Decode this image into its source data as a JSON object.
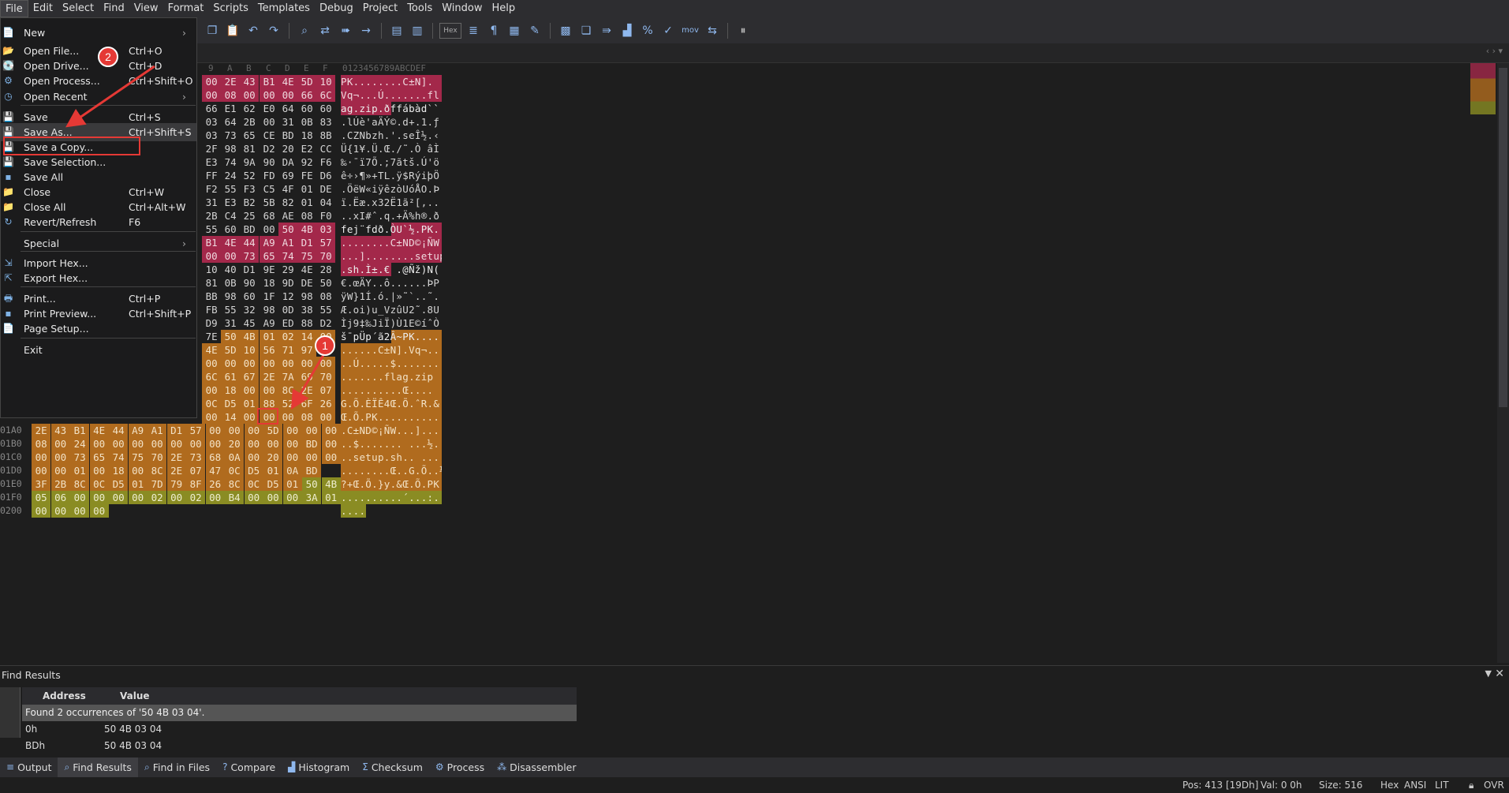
{
  "menubar": [
    "File",
    "Edit",
    "Select",
    "Find",
    "View",
    "Format",
    "Scripts",
    "Templates",
    "Debug",
    "Project",
    "Tools",
    "Window",
    "Help"
  ],
  "toolbar": {
    "hex_label": "Hex",
    "mov_label": "mov",
    "icons": [
      "copy-icon",
      "paste-icon",
      "undo-icon",
      "redo-icon",
      "find-icon",
      "find-replace-icon",
      "find-next-icon",
      "goto-icon",
      "bookmark-icon",
      "bookmark-next-icon",
      "hex-mode-icon",
      "encoding-icon",
      "pilcrow-icon",
      "columns-icon",
      "highlight-icon",
      "calculator-icon",
      "templates-icon",
      "run-icon",
      "histogram-icon",
      "percent-icon",
      "checksum-icon",
      "mov-icon",
      "compare-icon",
      "pause-icon"
    ]
  },
  "file_menu": [
    {
      "label": "New",
      "shortcut": "",
      "submenu": true,
      "icon": "new-file-icon"
    },
    {
      "label": "Open File...",
      "shortcut": "Ctrl+O",
      "icon": "open-folder-icon"
    },
    {
      "label": "Open Drive...",
      "shortcut": "Ctrl+D",
      "icon": "drive-icon"
    },
    {
      "label": "Open Process...",
      "shortcut": "Ctrl+Shift+O",
      "icon": "process-icon"
    },
    {
      "label": "Open Recent",
      "shortcut": "",
      "submenu": true,
      "icon": "recent-icon"
    },
    {
      "label": "Save",
      "shortcut": "Ctrl+S",
      "icon": "save-icon"
    },
    {
      "label": "Save As...",
      "shortcut": "Ctrl+Shift+S",
      "icon": "save-as-icon"
    },
    {
      "label": "Save a Copy...",
      "shortcut": "",
      "icon": "save-copy-icon"
    },
    {
      "label": "Save Selection...",
      "shortcut": "",
      "icon": "save-selection-icon"
    },
    {
      "label": "Save All",
      "shortcut": "",
      "icon": "save-all-icon"
    },
    {
      "label": "Close",
      "shortcut": "Ctrl+W",
      "icon": "close-file-icon"
    },
    {
      "label": "Close All",
      "shortcut": "Ctrl+Alt+W",
      "icon": "close-all-icon"
    },
    {
      "label": "Revert/Refresh",
      "shortcut": "F6",
      "icon": "refresh-icon"
    },
    {
      "label": "Special",
      "shortcut": "",
      "submenu": true,
      "icon": ""
    },
    {
      "label": "Import Hex...",
      "shortcut": "",
      "icon": "import-icon"
    },
    {
      "label": "Export Hex...",
      "shortcut": "",
      "icon": "export-icon"
    },
    {
      "label": "Print...",
      "shortcut": "Ctrl+P",
      "icon": "print-icon"
    },
    {
      "label": "Print Preview...",
      "shortcut": "Ctrl+Shift+P",
      "icon": "print-preview-icon"
    },
    {
      "label": "Page Setup...",
      "shortcut": "",
      "icon": "page-setup-icon"
    },
    {
      "label": "Exit",
      "shortcut": "",
      "icon": ""
    }
  ],
  "annotations": {
    "badge1": "1",
    "badge2": "2"
  },
  "hex_header": {
    "cols": [
      "9",
      "A",
      "B",
      "C",
      "D",
      "E",
      "F"
    ],
    "chars": "0123456789ABCDEF"
  },
  "hex_rows": [
    {
      "addr": "",
      "bytes": [
        "00",
        "2E",
        "43",
        "B1",
        "4E",
        "5D",
        "10"
      ],
      "colors": [
        "p",
        "p",
        "p",
        "p",
        "p",
        "p",
        "p"
      ],
      "chars": "PK........C±N].",
      "ccolor": "p"
    },
    {
      "addr": "",
      "bytes": [
        "00",
        "08",
        "00",
        "00",
        "00",
        "66",
        "6C"
      ],
      "colors": [
        "p",
        "p",
        "p",
        "p",
        "p",
        "p",
        "p"
      ],
      "chars": "Vq¬...Ú.......fl",
      "ccolor": "p"
    },
    {
      "addr": "",
      "bytes": [
        "66",
        "E1",
        "62",
        "E0",
        "64",
        "60",
        "60"
      ],
      "colors": [
        "n",
        "n",
        "n",
        "n",
        "n",
        "n",
        "n"
      ],
      "chars": "ag.zip.ðffábàd``",
      "ccolor": "pn"
    },
    {
      "addr": "",
      "bytes": [
        "03",
        "64",
        "2B",
        "00",
        "31",
        "0B",
        "83"
      ],
      "colors": [
        "n",
        "n",
        "n",
        "n",
        "n",
        "n",
        "n"
      ],
      "chars": ".lÚè'aÄÝ©.d+.1.ƒ",
      "ccolor": "n"
    },
    {
      "addr": "",
      "bytes": [
        "03",
        "73",
        "65",
        "CE",
        "BD",
        "18",
        "8B"
      ],
      "colors": [
        "n",
        "n",
        "n",
        "n",
        "n",
        "n",
        "n"
      ],
      "chars": ".CZNbzh.'.seÎ½.‹",
      "ccolor": "n"
    },
    {
      "addr": "",
      "bytes": [
        "2F",
        "98",
        "81",
        "D2",
        "20",
        "E2",
        "CC"
      ],
      "colors": [
        "n",
        "n",
        "n",
        "n",
        "n",
        "n",
        "n"
      ],
      "chars": "Ü{1¥.Ü.Œ./˜.Ò âÌ",
      "ccolor": "n"
    },
    {
      "addr": "",
      "bytes": [
        "E3",
        "74",
        "9A",
        "90",
        "DA",
        "92",
        "F6"
      ],
      "colors": [
        "n",
        "n",
        "n",
        "n",
        "n",
        "n",
        "n"
      ],
      "chars": "‰·¯ï7Õ.;7ãtš.Ú'ö",
      "ccolor": "n"
    },
    {
      "addr": "",
      "bytes": [
        "FF",
        "24",
        "52",
        "FD",
        "69",
        "FE",
        "D6"
      ],
      "colors": [
        "n",
        "n",
        "n",
        "n",
        "n",
        "n",
        "n"
      ],
      "chars": "ê÷›¶»+TL.ÿ$RýiþÖ",
      "ccolor": "n"
    },
    {
      "addr": "",
      "bytes": [
        "F2",
        "55",
        "F3",
        "C5",
        "4F",
        "01",
        "DE"
      ],
      "colors": [
        "n",
        "n",
        "n",
        "n",
        "n",
        "n",
        "n"
      ],
      "chars": ".ÖëW«iÿêzòUóÅO.Þ",
      "ccolor": "n"
    },
    {
      "addr": "",
      "bytes": [
        "31",
        "E3",
        "B2",
        "5B",
        "82",
        "01",
        "04"
      ],
      "colors": [
        "n",
        "n",
        "n",
        "n",
        "n",
        "n",
        "n"
      ],
      "chars": "ï.Ëæ.x32Ë1ã²[‚..",
      "ccolor": "n"
    },
    {
      "addr": "",
      "bytes": [
        "2B",
        "C4",
        "25",
        "68",
        "AE",
        "08",
        "F0"
      ],
      "colors": [
        "n",
        "n",
        "n",
        "n",
        "n",
        "n",
        "n"
      ],
      "chars": "..xI#ˆ.q.+Ä%h®.ð",
      "ccolor": "n"
    },
    {
      "addr": "",
      "bytes": [
        "55",
        "60",
        "BD",
        "00",
        "50",
        "4B",
        "03"
      ],
      "colors": [
        "n",
        "n",
        "n",
        "n",
        "p",
        "p",
        "p"
      ],
      "chars": "fej¨fdð.ÒU`½.PK.",
      "ccolor": "np"
    },
    {
      "addr": "",
      "bytes": [
        "B1",
        "4E",
        "44",
        "A9",
        "A1",
        "D1",
        "57"
      ],
      "colors": [
        "p",
        "p",
        "p",
        "p",
        "p",
        "p",
        "p"
      ],
      "chars": "........C±ND©¡ÑW",
      "ccolor": "p"
    },
    {
      "addr": "",
      "bytes": [
        "00",
        "00",
        "73",
        "65",
        "74",
        "75",
        "70"
      ],
      "colors": [
        "p",
        "p",
        "p",
        "p",
        "p",
        "p",
        "p"
      ],
      "chars": "...]........setup",
      "ccolor": "p"
    },
    {
      "addr": "",
      "bytes": [
        "10",
        "40",
        "D1",
        "9E",
        "29",
        "4E",
        "28"
      ],
      "colors": [
        "n",
        "n",
        "n",
        "n",
        "n",
        "n",
        "n"
      ],
      "chars": ".sh.Ì±.€ .@Ñž)N(",
      "ccolor": "pn"
    },
    {
      "addr": "",
      "bytes": [
        "81",
        "0B",
        "90",
        "18",
        "9D",
        "DE",
        "50"
      ],
      "colors": [
        "n",
        "n",
        "n",
        "n",
        "n",
        "n",
        "n"
      ],
      "chars": "€.œÄY..ô......ÞP",
      "ccolor": "n"
    },
    {
      "addr": "",
      "bytes": [
        "BB",
        "98",
        "60",
        "1F",
        "12",
        "98",
        "08"
      ],
      "colors": [
        "n",
        "n",
        "n",
        "n",
        "n",
        "n",
        "n"
      ],
      "chars": "ÿW}1Í.ó.|»˜`..˜.",
      "ccolor": "n"
    },
    {
      "addr": "",
      "bytes": [
        "FB",
        "55",
        "32",
        "98",
        "0D",
        "38",
        "55"
      ],
      "colors": [
        "n",
        "n",
        "n",
        "n",
        "n",
        "n",
        "n"
      ],
      "chars": "Æ.oi)u_VzûU2˜.8U",
      "ccolor": "n"
    },
    {
      "addr": "",
      "bytes": [
        "D9",
        "31",
        "45",
        "A9",
        "ED",
        "88",
        "D2"
      ],
      "colors": [
        "n",
        "n",
        "n",
        "n",
        "n",
        "n",
        "n"
      ],
      "chars": "Ìj9‡‰JiÏ)Ù1E©íˆÒ",
      "ccolor": "n"
    },
    {
      "addr": "",
      "bytes": [
        "7E",
        "50",
        "4B",
        "01",
        "02",
        "14",
        "00"
      ],
      "colors": [
        "n",
        "o",
        "o",
        "o",
        "o",
        "o",
        "o"
      ],
      "chars": "š¯pÜp´ã2Â~PK....",
      "ccolor": "no"
    },
    {
      "addr": "",
      "bytes": [
        "4E",
        "5D",
        "10",
        "56",
        "71",
        "97",
        ""
      ],
      "colors": [
        "o",
        "o",
        "o",
        "o",
        "o",
        "o",
        "o"
      ],
      "chars": "......C±N].Vq¬..",
      "ccolor": "o"
    },
    {
      "addr": "",
      "bytes": [
        "00",
        "00",
        "00",
        "00",
        "00",
        "00",
        "00"
      ],
      "colors": [
        "o",
        "o",
        "o",
        "o",
        "o",
        "o",
        "o"
      ],
      "chars": "..Ú.....$.......",
      "ccolor": "o"
    },
    {
      "addr": "",
      "bytes": [
        "6C",
        "61",
        "67",
        "2E",
        "7A",
        "69",
        "70"
      ],
      "colors": [
        "o",
        "o",
        "o",
        "o",
        "o",
        "o",
        "o"
      ],
      "chars": ".......flag.zip",
      "ccolor": "o"
    },
    {
      "addr": "",
      "bytes": [
        "00",
        "18",
        "00",
        "00",
        "8C",
        "2E",
        "07"
      ],
      "colors": [
        "o",
        "o",
        "o",
        "o",
        "o",
        "o",
        "o"
      ],
      "chars": "..........Œ....",
      "ccolor": "o"
    },
    {
      "addr": "",
      "bytes": [
        "0C",
        "D5",
        "01",
        "88",
        "52",
        "6F",
        "26"
      ],
      "colors": [
        "o",
        "o",
        "o",
        "o",
        "o",
        "o",
        "o"
      ],
      "chars": "G.Õ.ÈÏÊ4Œ.Õ.ˆR.&",
      "ccolor": "o"
    },
    {
      "addr": "",
      "bytes": [
        "00",
        "14",
        "00",
        "00",
        "00",
        "08",
        "00"
      ],
      "colors": [
        "o",
        "o",
        "o",
        "o",
        "o",
        "o",
        "o"
      ],
      "chars": "Œ.Õ.PK..........",
      "ccolor": "o"
    },
    {
      "addr": "01A0",
      "bytes": [
        "2E",
        "43",
        "B1",
        "4E",
        "44",
        "A9",
        "A1",
        "D1",
        "57",
        "00",
        "00",
        "00",
        "5D",
        "00",
        "00",
        "00"
      ],
      "colors": [
        "o",
        "o",
        "o",
        "o",
        "o",
        "o",
        "o",
        "o",
        "o",
        "o",
        "o",
        "o",
        "o",
        "o",
        "o",
        "o"
      ],
      "chars": ".C±ND©¡ÑW...]...",
      "ccolor": "o",
      "full": true
    },
    {
      "addr": "01B0",
      "bytes": [
        "08",
        "00",
        "24",
        "00",
        "00",
        "00",
        "00",
        "00",
        "00",
        "00",
        "20",
        "00",
        "00",
        "00",
        "BD",
        "00"
      ],
      "colors": [
        "o",
        "o",
        "o",
        "o",
        "o",
        "o",
        "o",
        "o",
        "o",
        "o",
        "o",
        "o",
        "o",
        "o",
        "o",
        "o"
      ],
      "chars": "..$....... ...½.",
      "ccolor": "o",
      "full": true
    },
    {
      "addr": "01C0",
      "bytes": [
        "00",
        "00",
        "73",
        "65",
        "74",
        "75",
        "70",
        "2E",
        "73",
        "68",
        "0A",
        "00",
        "20",
        "00",
        "00",
        "00"
      ],
      "colors": [
        "o",
        "o",
        "o",
        "o",
        "o",
        "o",
        "o",
        "o",
        "o",
        "o",
        "o",
        "o",
        "o",
        "o",
        "o",
        "o"
      ],
      "chars": "..setup.sh.. ...",
      "ccolor": "o",
      "full": true
    },
    {
      "addr": "01D0",
      "bytes": [
        "00",
        "00",
        "01",
        "00",
        "18",
        "00",
        "8C",
        "2E",
        "07",
        "47",
        "0C",
        "D5",
        "01",
        "0A",
        "BD",
        ""
      ],
      "colors": [
        "o",
        "o",
        "o",
        "o",
        "o",
        "o",
        "o",
        "o",
        "o",
        "o",
        "o",
        "o",
        "o",
        "o",
        "o",
        "o"
      ],
      "chars": "........Œ..G.Õ..½",
      "ccolor": "o",
      "full": true
    },
    {
      "addr": "01E0",
      "bytes": [
        "3F",
        "2B",
        "8C",
        "0C",
        "D5",
        "01",
        "7D",
        "79",
        "8F",
        "26",
        "8C",
        "0C",
        "D5",
        "01",
        "50",
        "4B"
      ],
      "colors": [
        "o",
        "o",
        "o",
        "o",
        "o",
        "o",
        "o",
        "o",
        "o",
        "o",
        "o",
        "o",
        "o",
        "o",
        "g",
        "g"
      ],
      "chars": "?+Œ.Õ.}y.&Œ.Õ.PK",
      "ccolor": "o",
      "full": true
    },
    {
      "addr": "01F0",
      "bytes": [
        "05",
        "06",
        "00",
        "00",
        "00",
        "00",
        "02",
        "00",
        "02",
        "00",
        "B4",
        "00",
        "00",
        "00",
        "3A",
        "01"
      ],
      "colors": [
        "g",
        "g",
        "g",
        "g",
        "g",
        "g",
        "g",
        "g",
        "g",
        "g",
        "g",
        "g",
        "g",
        "g",
        "g",
        "g"
      ],
      "chars": "..........´...:.",
      "ccolor": "g",
      "full": true
    },
    {
      "addr": "0200",
      "bytes": [
        "00",
        "00",
        "00",
        "00"
      ],
      "colors": [
        "g",
        "g",
        "g",
        "g"
      ],
      "chars": "....",
      "ccolor": "g",
      "full": true
    }
  ],
  "find_results": {
    "title": "Find Results",
    "col_address": "Address",
    "col_value": "Value",
    "summary": "Found 2 occurrences of '50 4B 03 04'.",
    "rows": [
      {
        "address": "0h",
        "value": "50 4B 03 04"
      },
      {
        "address": "BDh",
        "value": "50 4B 03 04"
      }
    ]
  },
  "bottom_tabs": [
    {
      "label": "Output",
      "icon": "output-icon",
      "active": false
    },
    {
      "label": "Find Results",
      "icon": "find-results-icon",
      "active": true
    },
    {
      "label": "Find in Files",
      "icon": "find-in-files-icon",
      "active": false
    },
    {
      "label": "Compare",
      "icon": "compare-icon",
      "active": false
    },
    {
      "label": "Histogram",
      "icon": "histogram-icon",
      "active": false
    },
    {
      "label": "Checksum",
      "icon": "checksum-icon",
      "active": false
    },
    {
      "label": "Process",
      "icon": "process-icon",
      "active": false
    },
    {
      "label": "Disassembler",
      "icon": "disassembler-icon",
      "active": false
    }
  ],
  "status": {
    "pos": "Pos: 413 [19Dh]",
    "val": "Val: 0 0h",
    "size": "Size: 516",
    "mode": "Hex",
    "encoding": "ANSI",
    "endian": "LIT",
    "ovr": "OVR"
  }
}
